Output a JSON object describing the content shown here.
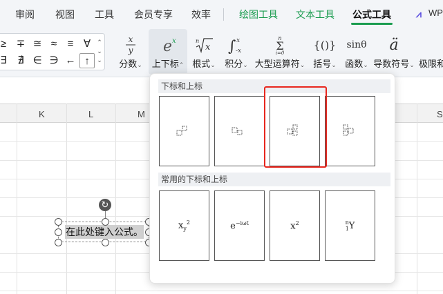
{
  "menu": {
    "items": [
      "审阅",
      "视图",
      "工具",
      "会员专享",
      "效率"
    ],
    "green_items": [
      "绘图工具",
      "文本工具"
    ],
    "active": "公式工具",
    "overflow": "WP"
  },
  "symbols": [
    "≥",
    "∓",
    "≅",
    "≈",
    "≡",
    "∀",
    "∃",
    "∄",
    "∈",
    "∋",
    "←",
    "↑"
  ],
  "ribbon": {
    "buttons": [
      {
        "label": "分数",
        "icon": "fraction-icon",
        "glyph": "x/y"
      },
      {
        "label": "上下标",
        "icon": "script-icon",
        "glyph": "eˣ"
      },
      {
        "label": "根式",
        "icon": "radical-icon",
        "glyph": "ⁿ√x"
      },
      {
        "label": "积分",
        "icon": "integral-icon",
        "glyph": "∫"
      },
      {
        "label": "大型运算符",
        "icon": "large-operator-icon",
        "glyph": "Σ"
      },
      {
        "label": "括号",
        "icon": "bracket-icon",
        "glyph": "{()}"
      },
      {
        "label": "函数",
        "icon": "function-icon",
        "glyph": "sinθ"
      },
      {
        "label": "导数符号",
        "icon": "accent-icon",
        "glyph": "ä"
      },
      {
        "label": "极限和",
        "icon": "limit-icon",
        "glyph": ""
      }
    ]
  },
  "sheet": {
    "columns": [
      "K",
      "L",
      "M",
      "S"
    ]
  },
  "equation": {
    "placeholder_text": "在此处键入公式。"
  },
  "panel": {
    "section1_title": "下标和上标",
    "section2_title": "常用的下标和上标",
    "common": [
      {
        "base": "x",
        "sub": "y",
        "sup": "2"
      },
      {
        "base": "e",
        "sup": "−iωt"
      },
      {
        "base": "x",
        "sup": "2"
      },
      {
        "base": "Y",
        "presup": "n",
        "presub": "1"
      }
    ]
  },
  "colors": {
    "accent_green": "#1a9c4f",
    "highlight_red": "#e8261d"
  }
}
